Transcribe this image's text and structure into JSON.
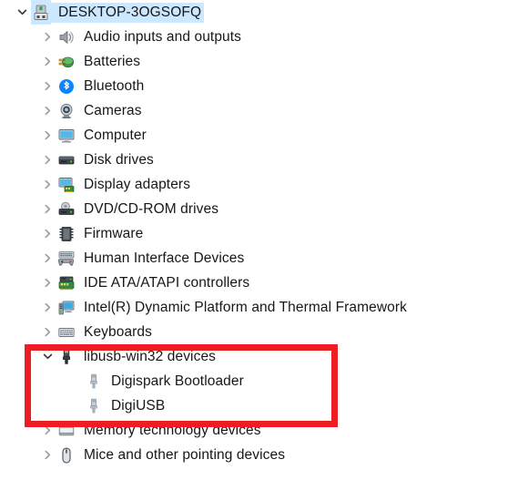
{
  "window": {
    "kind": "device-manager-tree",
    "background": "#ffffff",
    "selection_color": "#cce8ff",
    "highlight_color": "#ee1c25"
  },
  "tree": {
    "root": {
      "label": "DESKTOP-3OGSOFQ",
      "icon": "computer-node-icon",
      "expanded": true,
      "selected": true,
      "level": 0
    },
    "items": [
      {
        "label": "Audio inputs and outputs",
        "icon": "speaker-icon",
        "expanded": false,
        "level": 1,
        "highlighted": false
      },
      {
        "label": "Batteries",
        "icon": "battery-icon",
        "expanded": false,
        "level": 1,
        "highlighted": false
      },
      {
        "label": "Bluetooth",
        "icon": "bluetooth-icon",
        "expanded": false,
        "level": 1,
        "highlighted": false
      },
      {
        "label": "Cameras",
        "icon": "camera-icon",
        "expanded": false,
        "level": 1,
        "highlighted": false
      },
      {
        "label": "Computer",
        "icon": "monitor-icon",
        "expanded": false,
        "level": 1,
        "highlighted": false
      },
      {
        "label": "Disk drives",
        "icon": "disk-drive-icon",
        "expanded": false,
        "level": 1,
        "highlighted": false
      },
      {
        "label": "Display adapters",
        "icon": "display-adapter-icon",
        "expanded": false,
        "level": 1,
        "highlighted": false
      },
      {
        "label": "DVD/CD-ROM drives",
        "icon": "dvd-drive-icon",
        "expanded": false,
        "level": 1,
        "highlighted": false
      },
      {
        "label": "Firmware",
        "icon": "firmware-chip-icon",
        "expanded": false,
        "level": 1,
        "highlighted": false
      },
      {
        "label": "Human Interface Devices",
        "icon": "hid-gamepad-icon",
        "expanded": false,
        "level": 1,
        "highlighted": false
      },
      {
        "label": "IDE ATA/ATAPI controllers",
        "icon": "ide-controller-icon",
        "expanded": false,
        "level": 1,
        "highlighted": false
      },
      {
        "label": "Intel(R) Dynamic Platform and Thermal Framework",
        "icon": "intel-platform-icon",
        "expanded": false,
        "level": 1,
        "highlighted": false
      },
      {
        "label": "Keyboards",
        "icon": "keyboard-icon",
        "expanded": false,
        "level": 1,
        "highlighted": false
      },
      {
        "label": "libusb-win32 devices",
        "icon": "usb-connector-icon",
        "expanded": true,
        "level": 1,
        "highlighted": true
      },
      {
        "label": "Digispark Bootloader",
        "icon": "usb-device-icon",
        "expanded": null,
        "level": 2,
        "highlighted": true
      },
      {
        "label": "DigiUSB",
        "icon": "usb-device-icon",
        "expanded": null,
        "level": 2,
        "highlighted": true
      },
      {
        "label": "Memory technology devices",
        "icon": "memory-device-icon",
        "expanded": false,
        "level": 1,
        "highlighted": false
      },
      {
        "label": "Mice and other pointing devices",
        "icon": "mouse-icon",
        "expanded": false,
        "level": 1,
        "highlighted": false
      }
    ]
  },
  "annotation": {
    "name": "red-highlight-rectangle",
    "covers": [
      "libusb-win32 devices",
      "Digispark Bootloader",
      "DigiUSB"
    ]
  }
}
